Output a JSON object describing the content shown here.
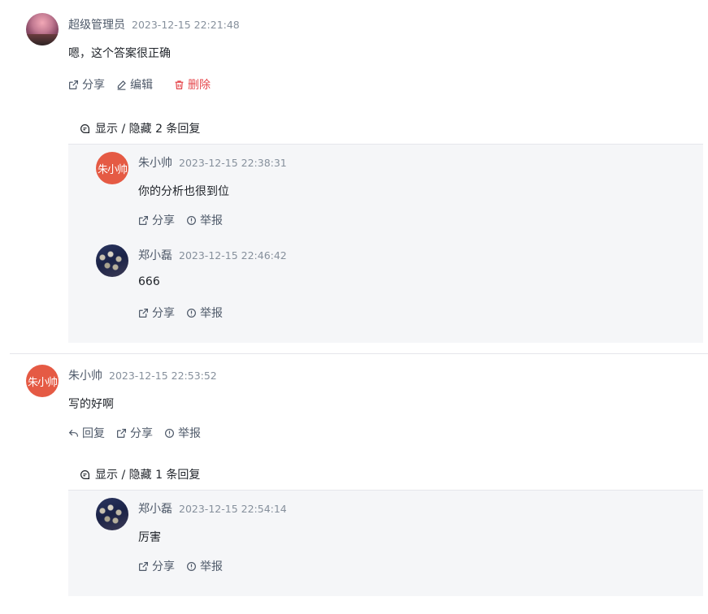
{
  "comments": [
    {
      "author": "超级管理员",
      "time": "2023-12-15 22:21:48",
      "content": "嗯，这个答案很正确",
      "actions": {
        "share": "分享",
        "edit": "编辑",
        "delete": "删除"
      },
      "toggle": "显示 / 隐藏 2 条回复",
      "replies": [
        {
          "author": "朱小帅",
          "avatar_text": "朱小帅",
          "time": "2023-12-15 22:38:31",
          "content": "你的分析也很到位",
          "share": "分享",
          "report": "举报"
        },
        {
          "author": "郑小磊",
          "time": "2023-12-15 22:46:42",
          "content": "666",
          "share": "分享",
          "report": "举报"
        }
      ]
    },
    {
      "author": "朱小帅",
      "avatar_text": "朱小帅",
      "time": "2023-12-15 22:53:52",
      "content": "写的好啊",
      "actions": {
        "reply": "回复",
        "share": "分享",
        "report": "举报"
      },
      "toggle": "显示 / 隐藏 1 条回复",
      "replies": [
        {
          "author": "郑小磊",
          "time": "2023-12-15 22:54:14",
          "content": "厉害",
          "share": "分享",
          "report": "举报"
        }
      ]
    }
  ],
  "icons": {
    "share": "share-icon",
    "edit": "edit-icon",
    "delete": "trash-icon",
    "reply": "reply-icon",
    "report": "info-icon",
    "toggle": "comment-icon"
  },
  "colors": {
    "danger": "#e5484d",
    "muted": "#86909c",
    "panel": "#f5f6f8",
    "avatar_red": "#e55a44"
  }
}
